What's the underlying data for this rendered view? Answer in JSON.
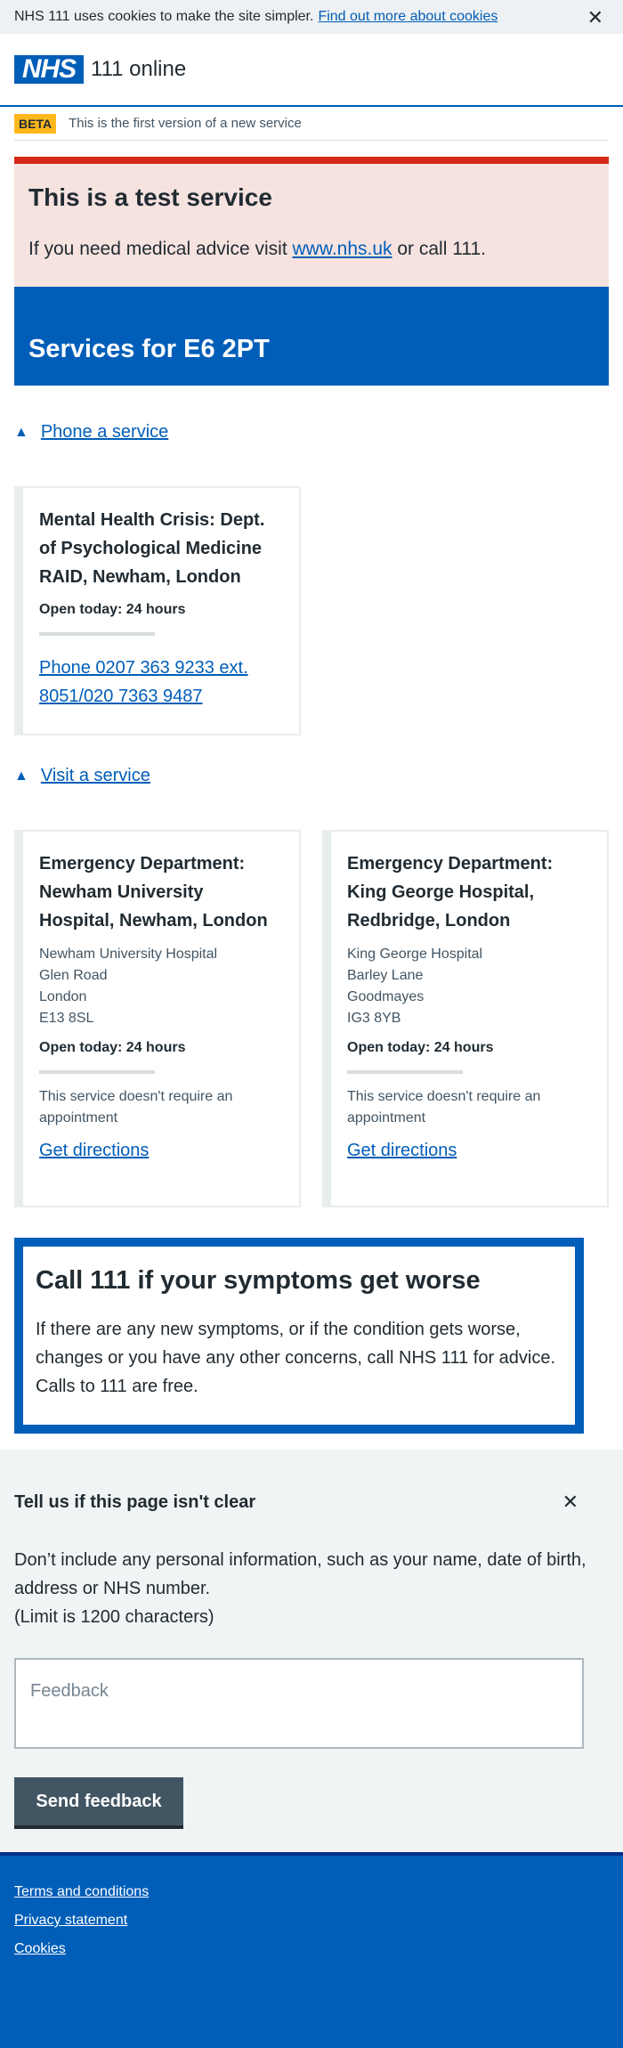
{
  "cookie_banner": {
    "text": "NHS 111 uses cookies to make the site simpler.",
    "link": "Find out more about cookies",
    "close": "✕"
  },
  "header": {
    "logo": "NHS",
    "service_name": "111 online"
  },
  "beta_banner": {
    "tag": "BETA",
    "text": "This is the first version of a new service"
  },
  "test_warning": {
    "title": "This is a test service",
    "text_before": "If you need medical advice visit ",
    "link": "www.nhs.uk",
    "text_after": " or call 111."
  },
  "services": {
    "title": "Services for E6 2PT"
  },
  "phone_section": {
    "toggle_label": "Phone a service",
    "cards": [
      {
        "title": "Mental Health Crisis: Dept. of Psychological Medicine RAID, Newham, London",
        "open": "Open today: 24 hours",
        "link": "Phone 0207 363 9233 ext. 8051/020 7363 9487"
      }
    ]
  },
  "visit_section": {
    "toggle_label": "Visit a service",
    "cards": [
      {
        "title": "Emergency Department: Newham University Hospital, Newham, London",
        "address": [
          "Newham University Hospital",
          "Glen Road",
          "London",
          "E13 8SL"
        ],
        "open": "Open today: 24 hours",
        "note": "This service doesn't require an appointment",
        "link": "Get directions"
      },
      {
        "title": "Emergency Department: King George Hospital, Redbridge, London",
        "address": [
          "King George Hospital",
          "Barley Lane",
          "Goodmayes",
          "IG3 8YB"
        ],
        "open": "Open today: 24 hours",
        "note": "This service doesn't require an appointment",
        "link": "Get directions"
      }
    ]
  },
  "call_box": {
    "title": "Call 111 if your symptoms get worse",
    "text": "If there are any new symptoms, or if the condition gets worse, changes or you have any other concerns, call NHS 111 for advice. Calls to 111 are free."
  },
  "feedback": {
    "title": "Tell us if this page isn't clear",
    "close": "✕",
    "description": "Don’t include any personal information, such as your name, date of birth, address or NHS number.",
    "limit": "(Limit is 1200 characters)",
    "placeholder": "Feedback",
    "button": "Send feedback"
  },
  "footer": {
    "links": [
      "Terms and conditions",
      "Privacy statement",
      "Cookies"
    ]
  }
}
